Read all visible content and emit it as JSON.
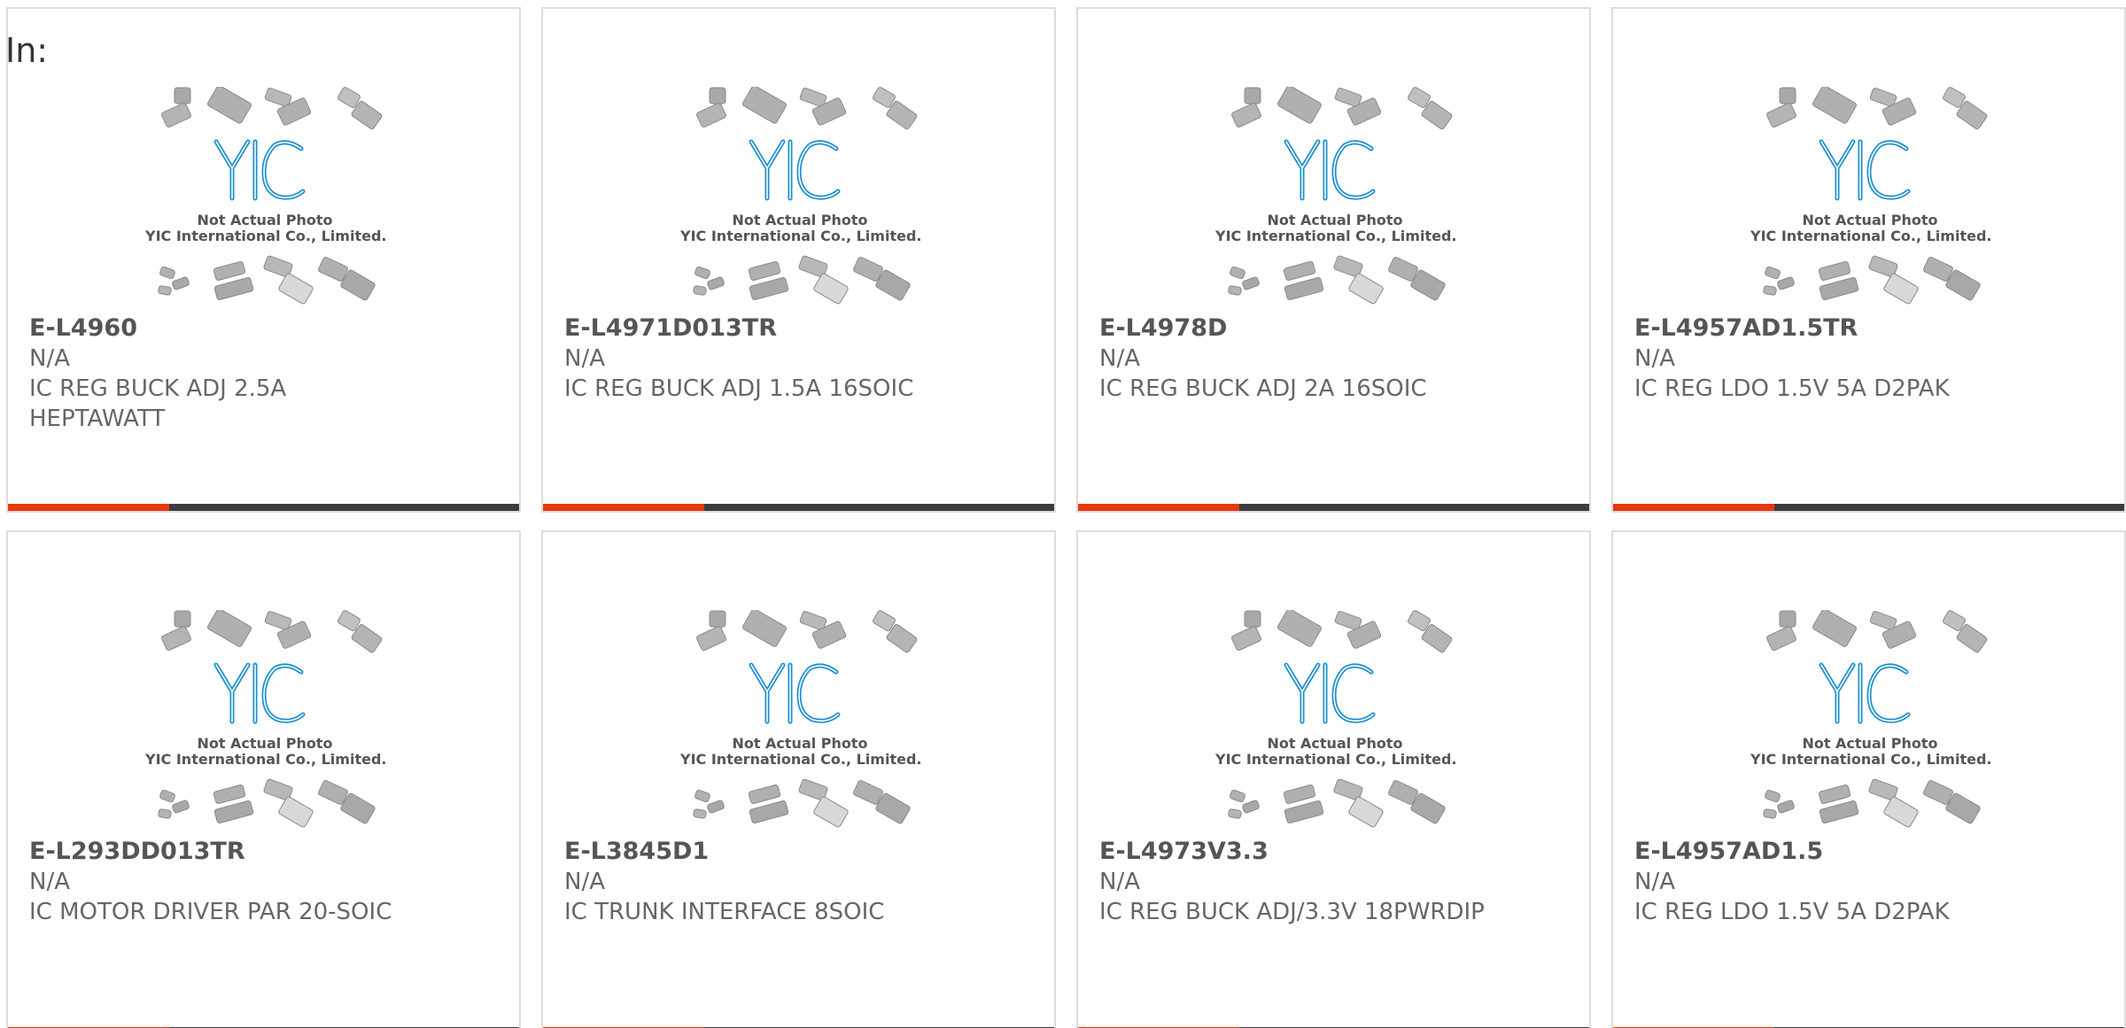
{
  "filter_label": "In:",
  "photo_note": {
    "line1": "Not Actual Photo",
    "line2": "YIC International Co., Limited."
  },
  "colors": {
    "accent": "#e8380d",
    "bar": "#3c3c3c",
    "logo_blue": "#1a8fd0"
  },
  "products": [
    {
      "part_number": "E-L4960",
      "manufacturer": "N/A",
      "description": "IC REG BUCK ADJ 2.5A HEPTAWATT"
    },
    {
      "part_number": "E-L4971D013TR",
      "manufacturer": "N/A",
      "description": "IC REG BUCK ADJ 1.5A 16SOIC"
    },
    {
      "part_number": "E-L4978D",
      "manufacturer": "N/A",
      "description": "IC REG BUCK ADJ 2A 16SOIC"
    },
    {
      "part_number": "E-L4957AD1.5TR",
      "manufacturer": "N/A",
      "description": "IC REG LDO 1.5V 5A D2PAK"
    },
    {
      "part_number": "E-L293DD013TR",
      "manufacturer": "N/A",
      "description": "IC MOTOR DRIVER PAR 20-SOIC"
    },
    {
      "part_number": "E-L3845D1",
      "manufacturer": "N/A",
      "description": "IC TRUNK INTERFACE 8SOIC"
    },
    {
      "part_number": "E-L4973V3.3",
      "manufacturer": "N/A",
      "description": "IC REG BUCK ADJ/3.3V 18PWRDIP"
    },
    {
      "part_number": "E-L4957AD1.5",
      "manufacturer": "N/A",
      "description": "IC REG LDO 1.5V 5A D2PAK"
    }
  ]
}
